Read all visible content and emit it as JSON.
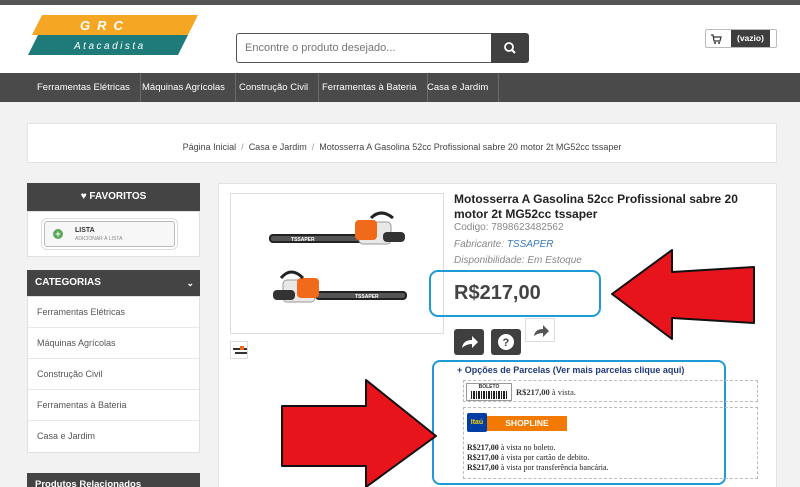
{
  "header": {
    "logo_top": "GRC",
    "logo_bottom": "Atacadista",
    "search_placeholder": "Encontre o produto desejado...",
    "cart_label": "(vazio)"
  },
  "nav": {
    "items": [
      "Ferramentas Elétricas",
      "Máquinas Agrícolas",
      "Construção Civil",
      "Ferramentas à Bateria",
      "Casa e Jardim"
    ]
  },
  "breadcrumb": {
    "items": [
      "Página Inicial",
      "Casa e Jardim",
      "Motosserra A Gasolina 52cc Profissional sabre 20 motor 2t MG52cc tssaper"
    ],
    "separator": "/"
  },
  "sidebar": {
    "favorites_title": "FAVORITOS",
    "lista_title": "LISTA",
    "lista_sub": "ADICIONAR À LISTA",
    "categories_title": "CATEGORIAS",
    "categories": [
      "Ferramentas Elétricas",
      "Máquinas Agrícolas",
      "Construção Civil",
      "Ferramentas à Bateria",
      "Casa e Jardim"
    ],
    "related_title": "Produtos Relacionados"
  },
  "product": {
    "title": "Motosserra A Gasolina 52cc Profissional sabre 20 motor 2t MG52cc tssaper",
    "code_label": "Codigo:",
    "code": "7898623482562",
    "maker_label": "Fabricante:",
    "maker": "TSSAPER",
    "availability_label": "Disponibilidade:",
    "availability": "Em Estoque",
    "price": "R$217,00",
    "brand_on_image": "TSSAPER"
  },
  "installments": {
    "header": "+ Opções de Parcelas (Ver mais parcelas clique aqui)",
    "boleto_logo": "BOLETO",
    "boleto_amount": "R$217,00",
    "boleto_suffix": "à vista.",
    "itau_logo": "Itaú",
    "shopline": "SHOPLINE",
    "lines": [
      {
        "amount": "R$217,00",
        "text": "à vista no boleto."
      },
      {
        "amount": "R$217,00",
        "text": "à vista por cartão de debito."
      },
      {
        "amount": "R$217,00",
        "text": "à vista por transferência bancária."
      }
    ]
  },
  "colors": {
    "nav_bg": "#4a4a4a",
    "highlight_outline": "#1e9ad6",
    "arrow_red": "#e8141c",
    "logo_teal": "#1e7b7a",
    "logo_orange": "#f5a623"
  }
}
